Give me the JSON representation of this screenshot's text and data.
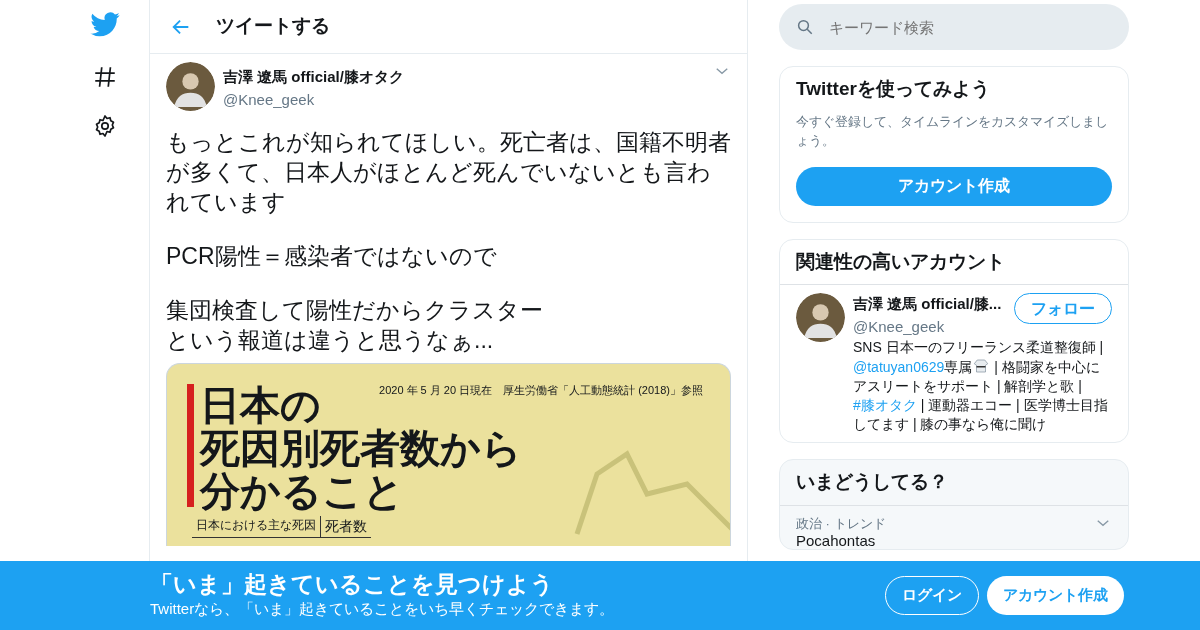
{
  "nav": [
    {
      "kind": "logo"
    },
    {
      "kind": "hash"
    },
    {
      "kind": "settings"
    }
  ],
  "header": {
    "title": "ツイートする"
  },
  "tweet": {
    "name": "吉澤 遼馬 official/膝オタク",
    "handle": "@Knee_geek",
    "paragraphs": [
      [
        "もっとこれが知られてほしい。死亡者は、国籍不明者が多くて、日本人がほとんど死んでいないとも言われています"
      ],
      [
        "PCR陽性＝感染者ではないので"
      ],
      [
        "集団検査して陽性だからクラスター",
        "という報道は違うと思うなぁ..."
      ]
    ],
    "media": {
      "note": "2020 年 5 月 20 日現在　厚生労働省「人工動態統計 (2018)」参照",
      "headline": [
        "日本の",
        "死因別死者数から",
        "分かること"
      ],
      "table_headers": [
        "日本における主な死因",
        "死者数"
      ]
    }
  },
  "search": {
    "placeholder": "キーワード検索"
  },
  "signup": {
    "title": "Twitterを使ってみよう",
    "text": "今すぐ登録して、タイムラインをカスタマイズしましょう。",
    "button": "アカウント作成"
  },
  "related": {
    "title": "関連性の高いアカウント",
    "accounts": [
      {
        "name": "吉澤 遼馬 official/膝...",
        "handle": "@Knee_geek",
        "follow": "フォロー",
        "bio": [
          {
            "kind": "text",
            "text": "SNS 日本一のフリーランス柔道整復師 | "
          },
          {
            "kind": "link",
            "text": "@tatuyan0629"
          },
          {
            "kind": "text",
            "text": "専属"
          },
          {
            "kind": "emoji"
          },
          {
            "kind": "text",
            "text": " | 格闘家を中心にアスリートをサポート | 解剖学と歌 | "
          },
          {
            "kind": "link",
            "text": "#膝オタク"
          },
          {
            "kind": "text",
            "text": " | 運動器エコー | 医学博士目指してます | 膝の事なら俺に聞け"
          }
        ]
      }
    ]
  },
  "trends": {
    "title": "いまどうしてる？",
    "items": [
      {
        "context": "政治 · トレンド",
        "name": "Pocahontas"
      }
    ]
  },
  "banner": {
    "title": "「いま」起きていることを見つけよう",
    "text": "Twitterなら、「いま」起きていることをいち早くチェックできます。",
    "login": "ログイン",
    "signup": "アカウント作成"
  }
}
